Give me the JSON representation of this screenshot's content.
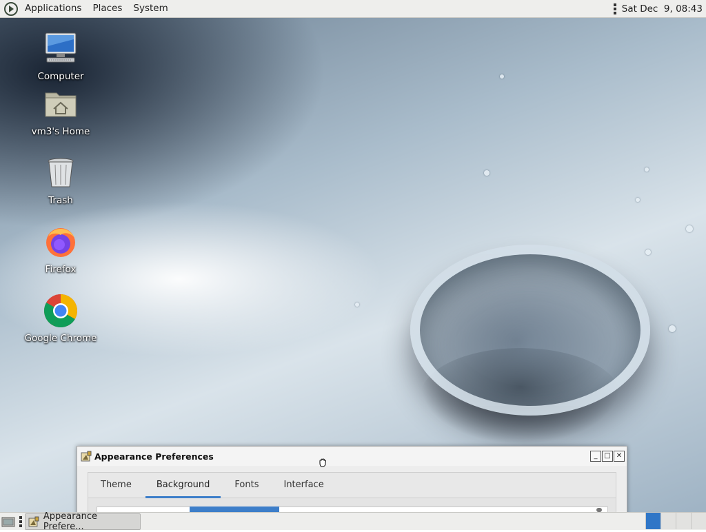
{
  "top_panel": {
    "menus": [
      "Applications",
      "Places",
      "System"
    ],
    "clock": "Sat Dec  9, 08:43"
  },
  "desktop_icons": [
    {
      "label": "Computer",
      "icon": "computer-icon"
    },
    {
      "label": "vm3's Home",
      "icon": "home-folder-icon"
    },
    {
      "label": "Trash",
      "icon": "trash-icon"
    },
    {
      "label": "Firefox",
      "icon": "firefox-icon"
    },
    {
      "label": "Google Chrome",
      "icon": "chrome-icon"
    }
  ],
  "window": {
    "title": "Appearance Preferences",
    "tabs": [
      "Theme",
      "Background",
      "Fonts",
      "Interface"
    ],
    "active_tab": "Background"
  },
  "bottom_panel": {
    "task_label": "Appearance Prefere...",
    "workspaces": 4,
    "active_workspace": 1
  },
  "colors": {
    "accent": "#3d7ec9",
    "panel": "#eeeeec"
  }
}
